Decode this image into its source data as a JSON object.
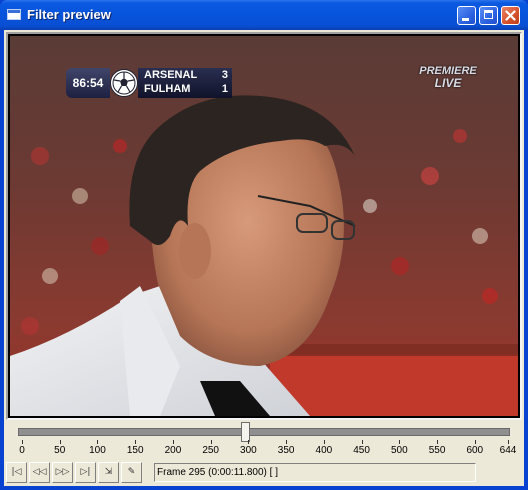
{
  "window": {
    "title": "Filter preview"
  },
  "titlebar_buttons": {
    "minimize": "minimize-icon",
    "maximize": "maximize-icon",
    "close": "close-icon"
  },
  "video": {
    "scorebug": {
      "clock": "86:54",
      "home_team": "ARSENAL",
      "home_score": "3",
      "away_team": "FULHAM",
      "away_score": "1"
    },
    "broadcaster_line1": "PREMIERE",
    "broadcaster_line2": "LIVE"
  },
  "timeline": {
    "position_fraction": 0.458,
    "tick_labels": [
      "0",
      "50",
      "100",
      "150",
      "200",
      "250",
      "300",
      "350",
      "400",
      "450",
      "500",
      "550",
      "600",
      "644"
    ]
  },
  "toolbar": {
    "buttons": [
      {
        "name": "go-to-start-icon",
        "glyph": "|◁"
      },
      {
        "name": "previous-keyframe-icon",
        "glyph": "◁◁"
      },
      {
        "name": "next-keyframe-icon",
        "glyph": "▷▷"
      },
      {
        "name": "go-to-end-icon",
        "glyph": "▷|"
      },
      {
        "name": "go-to-frame-icon",
        "glyph": "⇲"
      },
      {
        "name": "mark-frame-icon",
        "glyph": "✎"
      }
    ],
    "status_text": "Frame 295 (0:00:11.800) [ ]"
  },
  "colors": {
    "titlebar": "#0654dc",
    "client": "#ece9d8",
    "pitch_red": "#c0392b"
  }
}
